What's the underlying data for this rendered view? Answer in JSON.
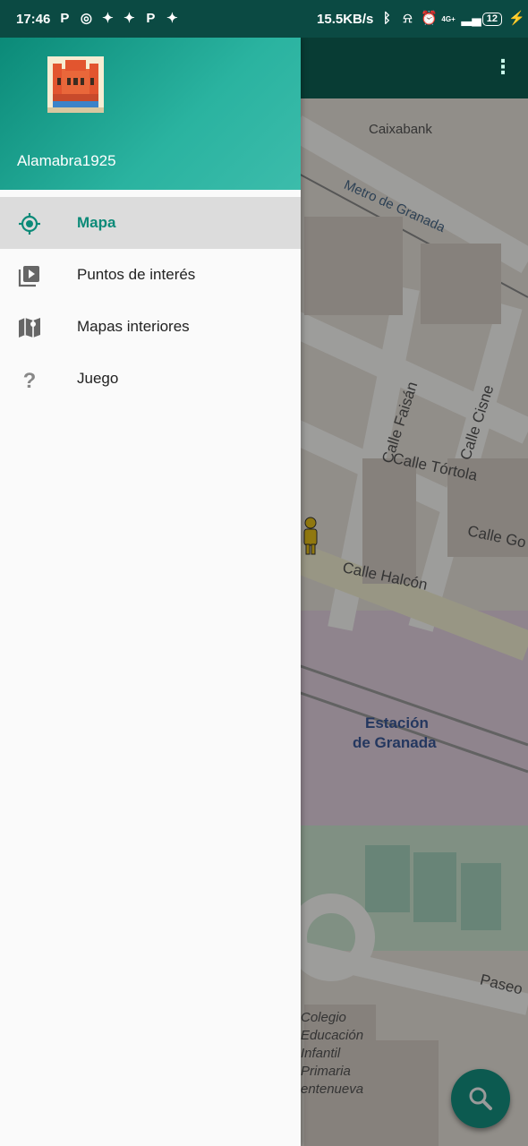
{
  "status_bar": {
    "time": "17:46",
    "network_speed": "15.5KB/s",
    "battery": "12",
    "network_type": "4G+"
  },
  "drawer": {
    "username": "Alamabra1925",
    "items": [
      {
        "label": "Mapa",
        "icon": "location-target-icon",
        "active": true
      },
      {
        "label": "Puntos de interés",
        "icon": "video-library-icon",
        "active": false
      },
      {
        "label": "Mapas interiores",
        "icon": "map-icon",
        "active": false
      },
      {
        "label": "Juego",
        "icon": "question-mark-icon",
        "active": false
      }
    ]
  },
  "map": {
    "labels": {
      "caixabank": "Caixabank",
      "metro": "Metro de Granada",
      "calle_faisan": "Calle Faisán",
      "calle_cisne": "Calle Cisne",
      "calle_tortola": "Calle Tórtola",
      "calle_go": "Calle Go",
      "calle_halcon": "Calle Halcón",
      "estacion1": "Estación",
      "estacion2": "de Granada",
      "paseo": "Paseo",
      "colegio1": "Colegio",
      "colegio2": "Educación",
      "colegio3": "Infantil",
      "colegio4": "Primaria",
      "colegio5": "entenueva"
    }
  },
  "colors": {
    "accent": "#0b8a78",
    "appbar": "#0e6155",
    "statusbar": "#0b4a43"
  }
}
